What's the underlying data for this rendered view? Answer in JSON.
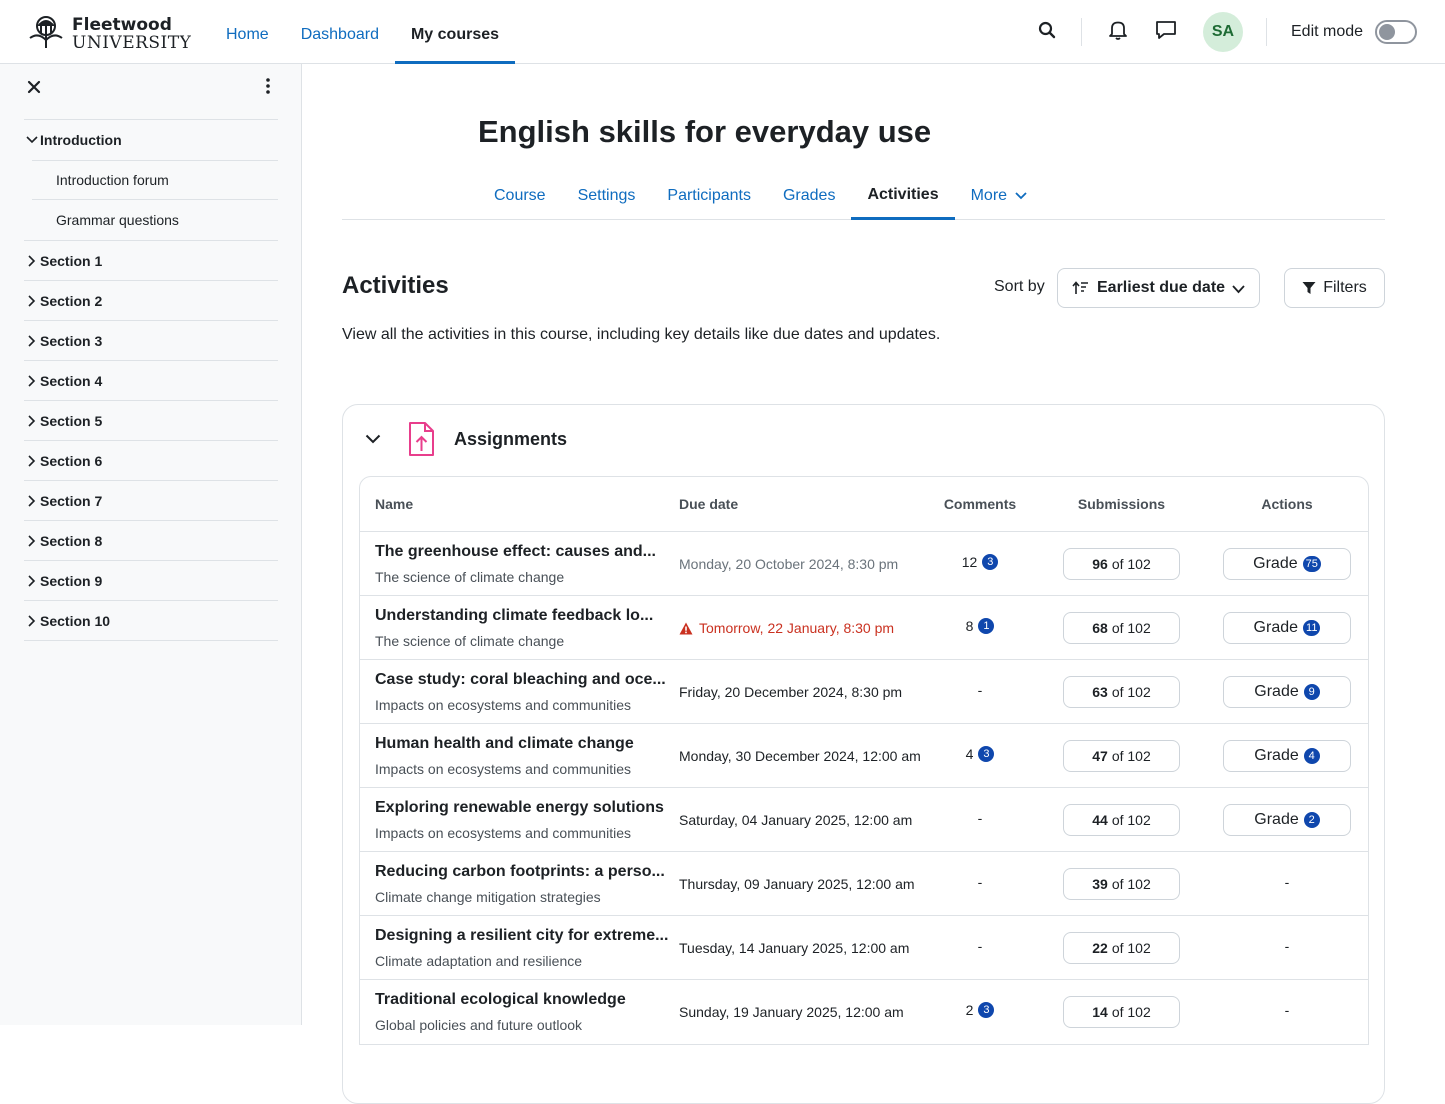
{
  "brand": {
    "name_line1": "Fleetwood",
    "name_line2": "UNIVERSITY"
  },
  "nav": {
    "home": "Home",
    "dashboard": "Dashboard",
    "my_courses": "My courses"
  },
  "user": {
    "initials": "SA",
    "edit_mode_label": "Edit mode",
    "edit_mode_on": false
  },
  "drawer": {
    "items": [
      {
        "label": "Introduction",
        "expanded": true,
        "children": [
          "Introduction forum",
          "Grammar questions"
        ]
      },
      {
        "label": "Section 1"
      },
      {
        "label": "Section 2"
      },
      {
        "label": "Section 3"
      },
      {
        "label": "Section 4"
      },
      {
        "label": "Section 5"
      },
      {
        "label": "Section 6"
      },
      {
        "label": "Section 7"
      },
      {
        "label": "Section 8"
      },
      {
        "label": "Section 9"
      },
      {
        "label": "Section 10"
      }
    ]
  },
  "course": {
    "title": "English skills for everyday use",
    "tabs": [
      "Course",
      "Settings",
      "Participants",
      "Grades",
      "Activities",
      "More"
    ],
    "active_tab": "Activities"
  },
  "activities": {
    "heading": "Activities",
    "sort_label": "Sort by",
    "sort_value": "Earliest due date",
    "filters_label": "Filters",
    "description": "View all the activities in this course, including key details like due dates and updates."
  },
  "assignments": {
    "title": "Assignments",
    "accent_color": "#e83e8c",
    "columns": {
      "name": "Name",
      "due": "Due date",
      "comments": "Comments",
      "submissions": "Submissions",
      "actions": "Actions"
    },
    "rows": [
      {
        "name": "The greenhouse effect: causes and...",
        "section": "The science of climate change",
        "due": "Monday, 20 October 2024, 8:30 pm",
        "due_state": "past",
        "comments": "12",
        "comments_new": "3",
        "submitted": "96",
        "of": "of 102",
        "grade_label": "Grade",
        "grade_count": "75"
      },
      {
        "name": "Understanding climate feedback lo...",
        "section": "The science of climate change",
        "due": "Tomorrow, 22 January, 8:30 pm",
        "due_state": "warn",
        "comments": "8",
        "comments_new": "1",
        "submitted": "68",
        "of": "of 102",
        "grade_label": "Grade",
        "grade_count": "11"
      },
      {
        "name": "Case study: coral bleaching and oce...",
        "section": "Impacts on ecosystems and communities",
        "due": "Friday, 20 December 2024, 8:30 pm",
        "due_state": "normal",
        "comments": "-",
        "comments_new": "",
        "submitted": "63",
        "of": "of 102",
        "grade_label": "Grade",
        "grade_count": "9"
      },
      {
        "name": "Human health and climate change",
        "section": "Impacts on ecosystems and communities",
        "due": "Monday, 30 December 2024,  12:00 am",
        "due_state": "normal",
        "comments": "4",
        "comments_new": "3",
        "submitted": "47",
        "of": "of 102",
        "grade_label": "Grade",
        "grade_count": "4"
      },
      {
        "name": "Exploring renewable energy solutions",
        "section": "Impacts on ecosystems and communities",
        "due": "Saturday, 04 January 2025,  12:00 am",
        "due_state": "normal",
        "comments": "-",
        "comments_new": "",
        "submitted": "44",
        "of": "of 102",
        "grade_label": "Grade",
        "grade_count": "2"
      },
      {
        "name": "Reducing carbon footprints: a perso...",
        "section": "Climate change mitigation strategies",
        "due": "Thursday, 09 January 2025,  12:00 am",
        "due_state": "normal",
        "comments": "-",
        "comments_new": "",
        "submitted": "39",
        "of": "of 102",
        "grade_label": "",
        "grade_count": "",
        "action_dash": "-"
      },
      {
        "name": "Designing a resilient city for extreme...",
        "section": "Climate adaptation and resilience",
        "due": "Tuesday, 14 January 2025,  12:00 am",
        "due_state": "normal",
        "comments": "-",
        "comments_new": "",
        "submitted": "22",
        "of": "of 102",
        "grade_label": "",
        "grade_count": "",
        "action_dash": "-"
      },
      {
        "name": "Traditional ecological knowledge",
        "section": "Global policies and future outlook",
        "due": "Sunday, 19 January 2025,  12:00 am",
        "due_state": "normal",
        "comments": "2",
        "comments_new": "3",
        "submitted": "14",
        "of": "of 102",
        "grade_label": "",
        "grade_count": "",
        "action_dash": "-"
      }
    ]
  }
}
